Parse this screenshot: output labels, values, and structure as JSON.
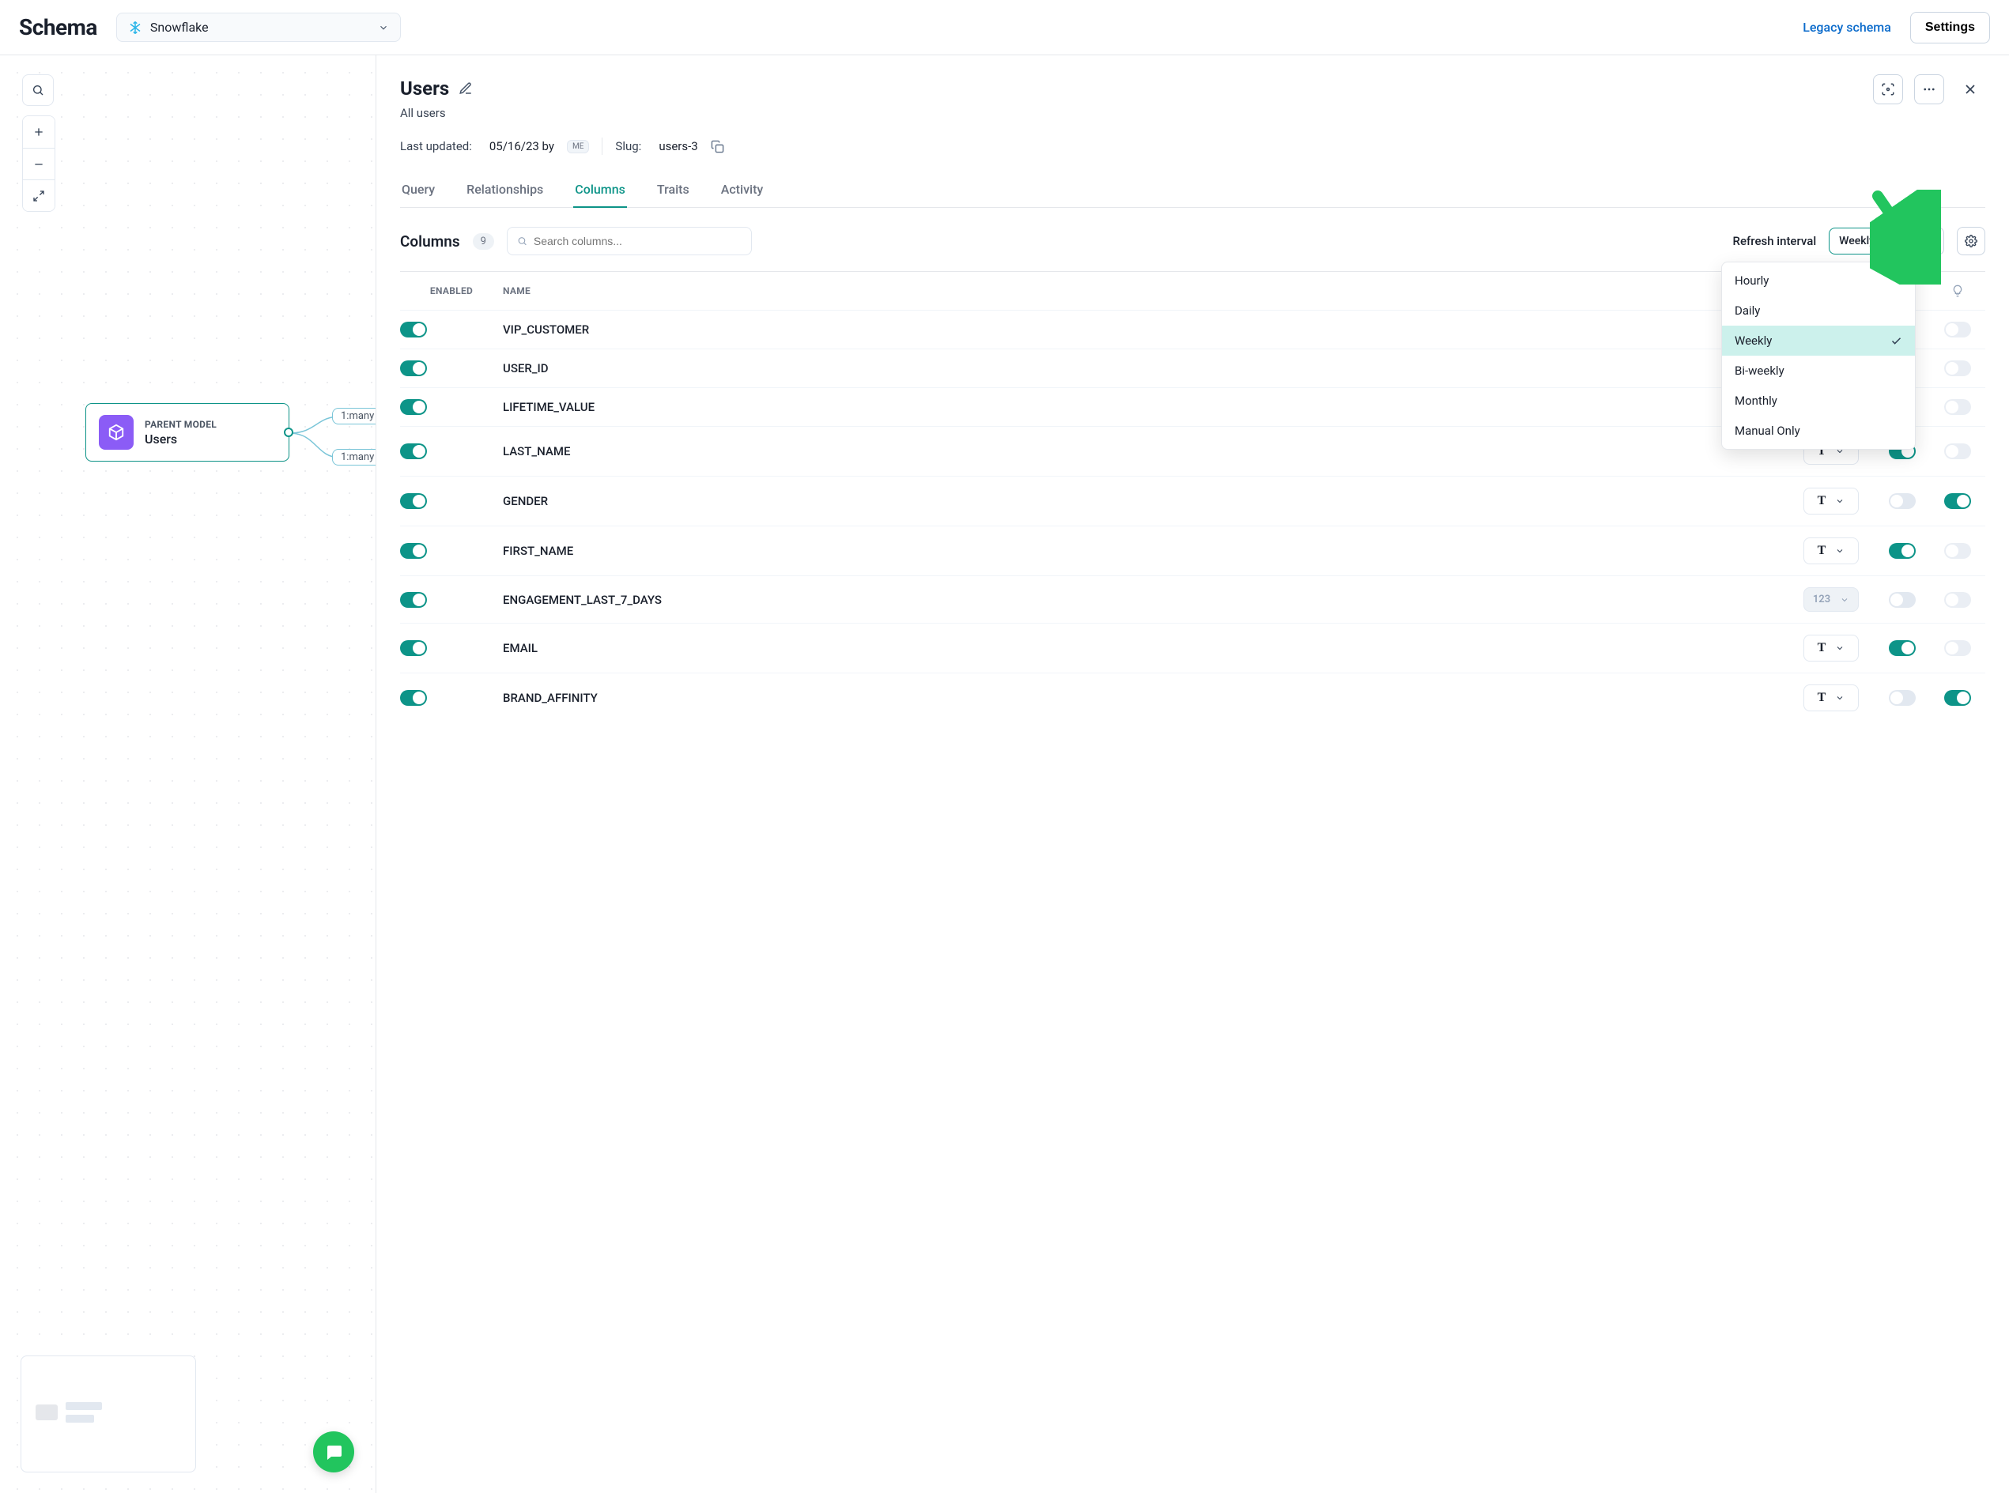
{
  "brand": "Schema",
  "source": {
    "label": "Snowflake"
  },
  "topbar": {
    "legacy": "Legacy schema",
    "settings": "Settings"
  },
  "canvas": {
    "node": {
      "kind": "PARENT MODEL",
      "title": "Users"
    },
    "edges": [
      "1:many",
      "1:many"
    ]
  },
  "panel": {
    "title": "Users",
    "subtitle": "All users",
    "last_updated_label": "Last updated:",
    "last_updated_value": "05/16/23 by",
    "user_badge": "ME",
    "slug_label": "Slug:",
    "slug_value": "users-3"
  },
  "tabs": [
    "Query",
    "Relationships",
    "Columns",
    "Traits",
    "Activity"
  ],
  "active_tab": "Columns",
  "columns_bar": {
    "title": "Columns",
    "count": "9",
    "search_placeholder": "Search columns...",
    "refresh_label": "Refresh interval",
    "interval_value": "Weekly"
  },
  "interval_options": [
    "Hourly",
    "Daily",
    "Weekly",
    "Bi-weekly",
    "Monthly",
    "Manual Only"
  ],
  "interval_selected": "Weekly",
  "table": {
    "headers": {
      "enabled": "ENABLED",
      "name": "NAME"
    },
    "rows": [
      {
        "name": "VIP_CUSTOMER",
        "enabled": true,
        "type": null,
        "t1": null,
        "t2": false
      },
      {
        "name": "USER_ID",
        "enabled": true,
        "type": null,
        "t1": null,
        "t2": false
      },
      {
        "name": "LIFETIME_VALUE",
        "enabled": true,
        "type": null,
        "t1": null,
        "t2": false
      },
      {
        "name": "LAST_NAME",
        "enabled": true,
        "type": "T",
        "t1": true,
        "t2": false
      },
      {
        "name": "GENDER",
        "enabled": true,
        "type": "T",
        "t1": false,
        "t2": true
      },
      {
        "name": "FIRST_NAME",
        "enabled": true,
        "type": "T",
        "t1": true,
        "t2": false
      },
      {
        "name": "ENGAGEMENT_LAST_7_DAYS",
        "enabled": true,
        "type": "123",
        "type_disabled": true,
        "t1": false,
        "t2": false
      },
      {
        "name": "EMAIL",
        "enabled": true,
        "type": "T",
        "t1": true,
        "t2": false
      },
      {
        "name": "BRAND_AFFINITY",
        "enabled": true,
        "type": "T",
        "t1": false,
        "t2": true
      }
    ]
  }
}
